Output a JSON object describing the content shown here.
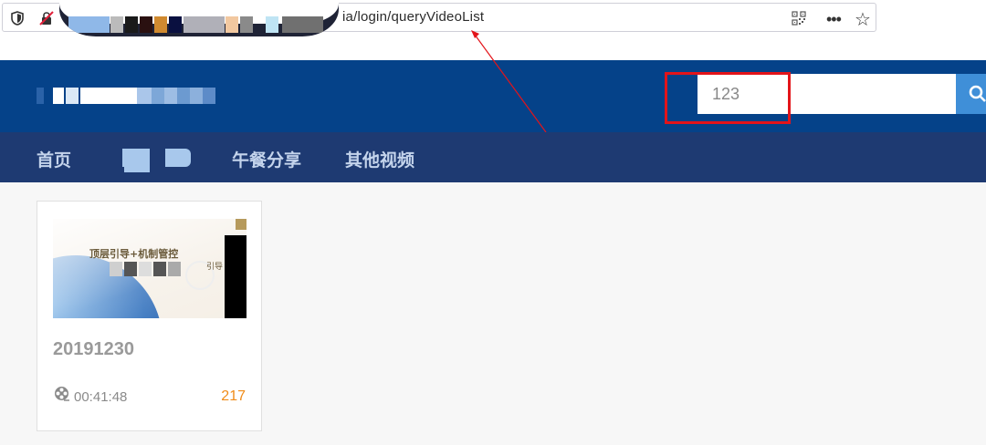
{
  "browser": {
    "url_visible": "ia/login/queryVideoList",
    "icons": [
      "shield-icon",
      "lock-off-icon",
      "qr-code-icon",
      "more-dots-icon",
      "bookmark-star-icon"
    ]
  },
  "header": {
    "search": {
      "value": "123"
    },
    "search_icon": "search-icon",
    "highlight_color": "#e3141a",
    "bg_color": "#054289"
  },
  "nav": {
    "items": [
      {
        "label": "首页"
      },
      {
        "label": ""
      },
      {
        "label": "午餐分享"
      },
      {
        "label": "其他视频"
      }
    ],
    "bg_color": "#1e3a72"
  },
  "videos": [
    {
      "thumbnail_text": "顶层引导+机制管控",
      "thumbnail_side_text": "引导",
      "title": "20191230",
      "duration": "00:41:48",
      "views": "217",
      "views_color": "#f08c1a"
    }
  ]
}
